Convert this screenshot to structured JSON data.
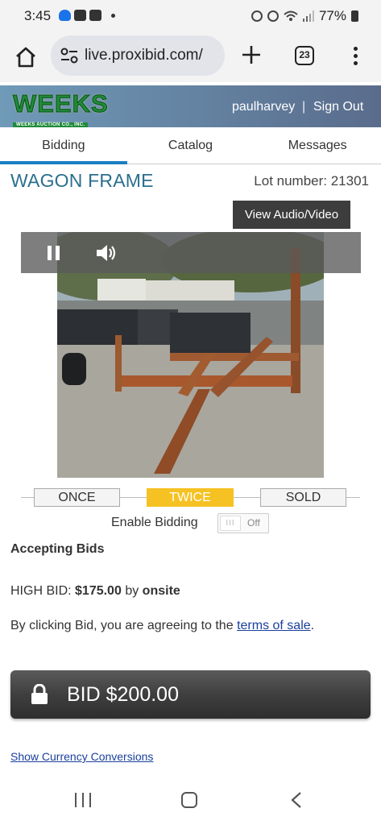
{
  "status_bar": {
    "time": "3:45",
    "battery": "77%",
    "icons": [
      "telegram-icon",
      "youtube-icon",
      "youtube-icon",
      "alarm-icon",
      "hotspot-icon",
      "wifi-icon",
      "signal-icon",
      "battery-icon"
    ]
  },
  "browser": {
    "url": "live.proxibid.com/",
    "tab_count": "23"
  },
  "header": {
    "logo_text": "WEEKS",
    "logo_subtext": "WEEKS AUCTION CO., INC.",
    "username": "paulharvey",
    "separator": "|",
    "sign_out": "Sign Out",
    "gradient_colors": [
      "#6f9ab8",
      "#5a6c8c"
    ]
  },
  "tabs": [
    {
      "label": "Bidding",
      "active": true
    },
    {
      "label": "Catalog",
      "active": false
    },
    {
      "label": "Messages",
      "active": false
    }
  ],
  "lot": {
    "title": "WAGON FRAME",
    "lot_number_label": "Lot number: 21301",
    "view_av_label": "View Audio/Video"
  },
  "auction_status": {
    "steps": [
      {
        "label": "ONCE",
        "active": false
      },
      {
        "label": "TWICE",
        "active": true
      },
      {
        "label": "SOLD",
        "active": false
      }
    ],
    "active_color": "#f6c223"
  },
  "bidding": {
    "enable_label": "Enable Bidding",
    "toggle_knob": "III",
    "toggle_state": "Off",
    "accepting_text": "Accepting Bids",
    "high_bid_label": "HIGH BID:",
    "high_bid_amount": "$175.00",
    "high_bid_by": "by",
    "high_bidder": "onsite",
    "terms_prefix": "By clicking Bid, you are agreeing to the",
    "terms_link": "terms of sale",
    "terms_suffix": ".",
    "bid_button": "BID $200.00",
    "currency_link": "Show Currency Conversions"
  },
  "colors": {
    "title_blue": "#2b6f8e",
    "tab_underline": "#1a7fc1",
    "link_blue": "#1a3f9c"
  }
}
